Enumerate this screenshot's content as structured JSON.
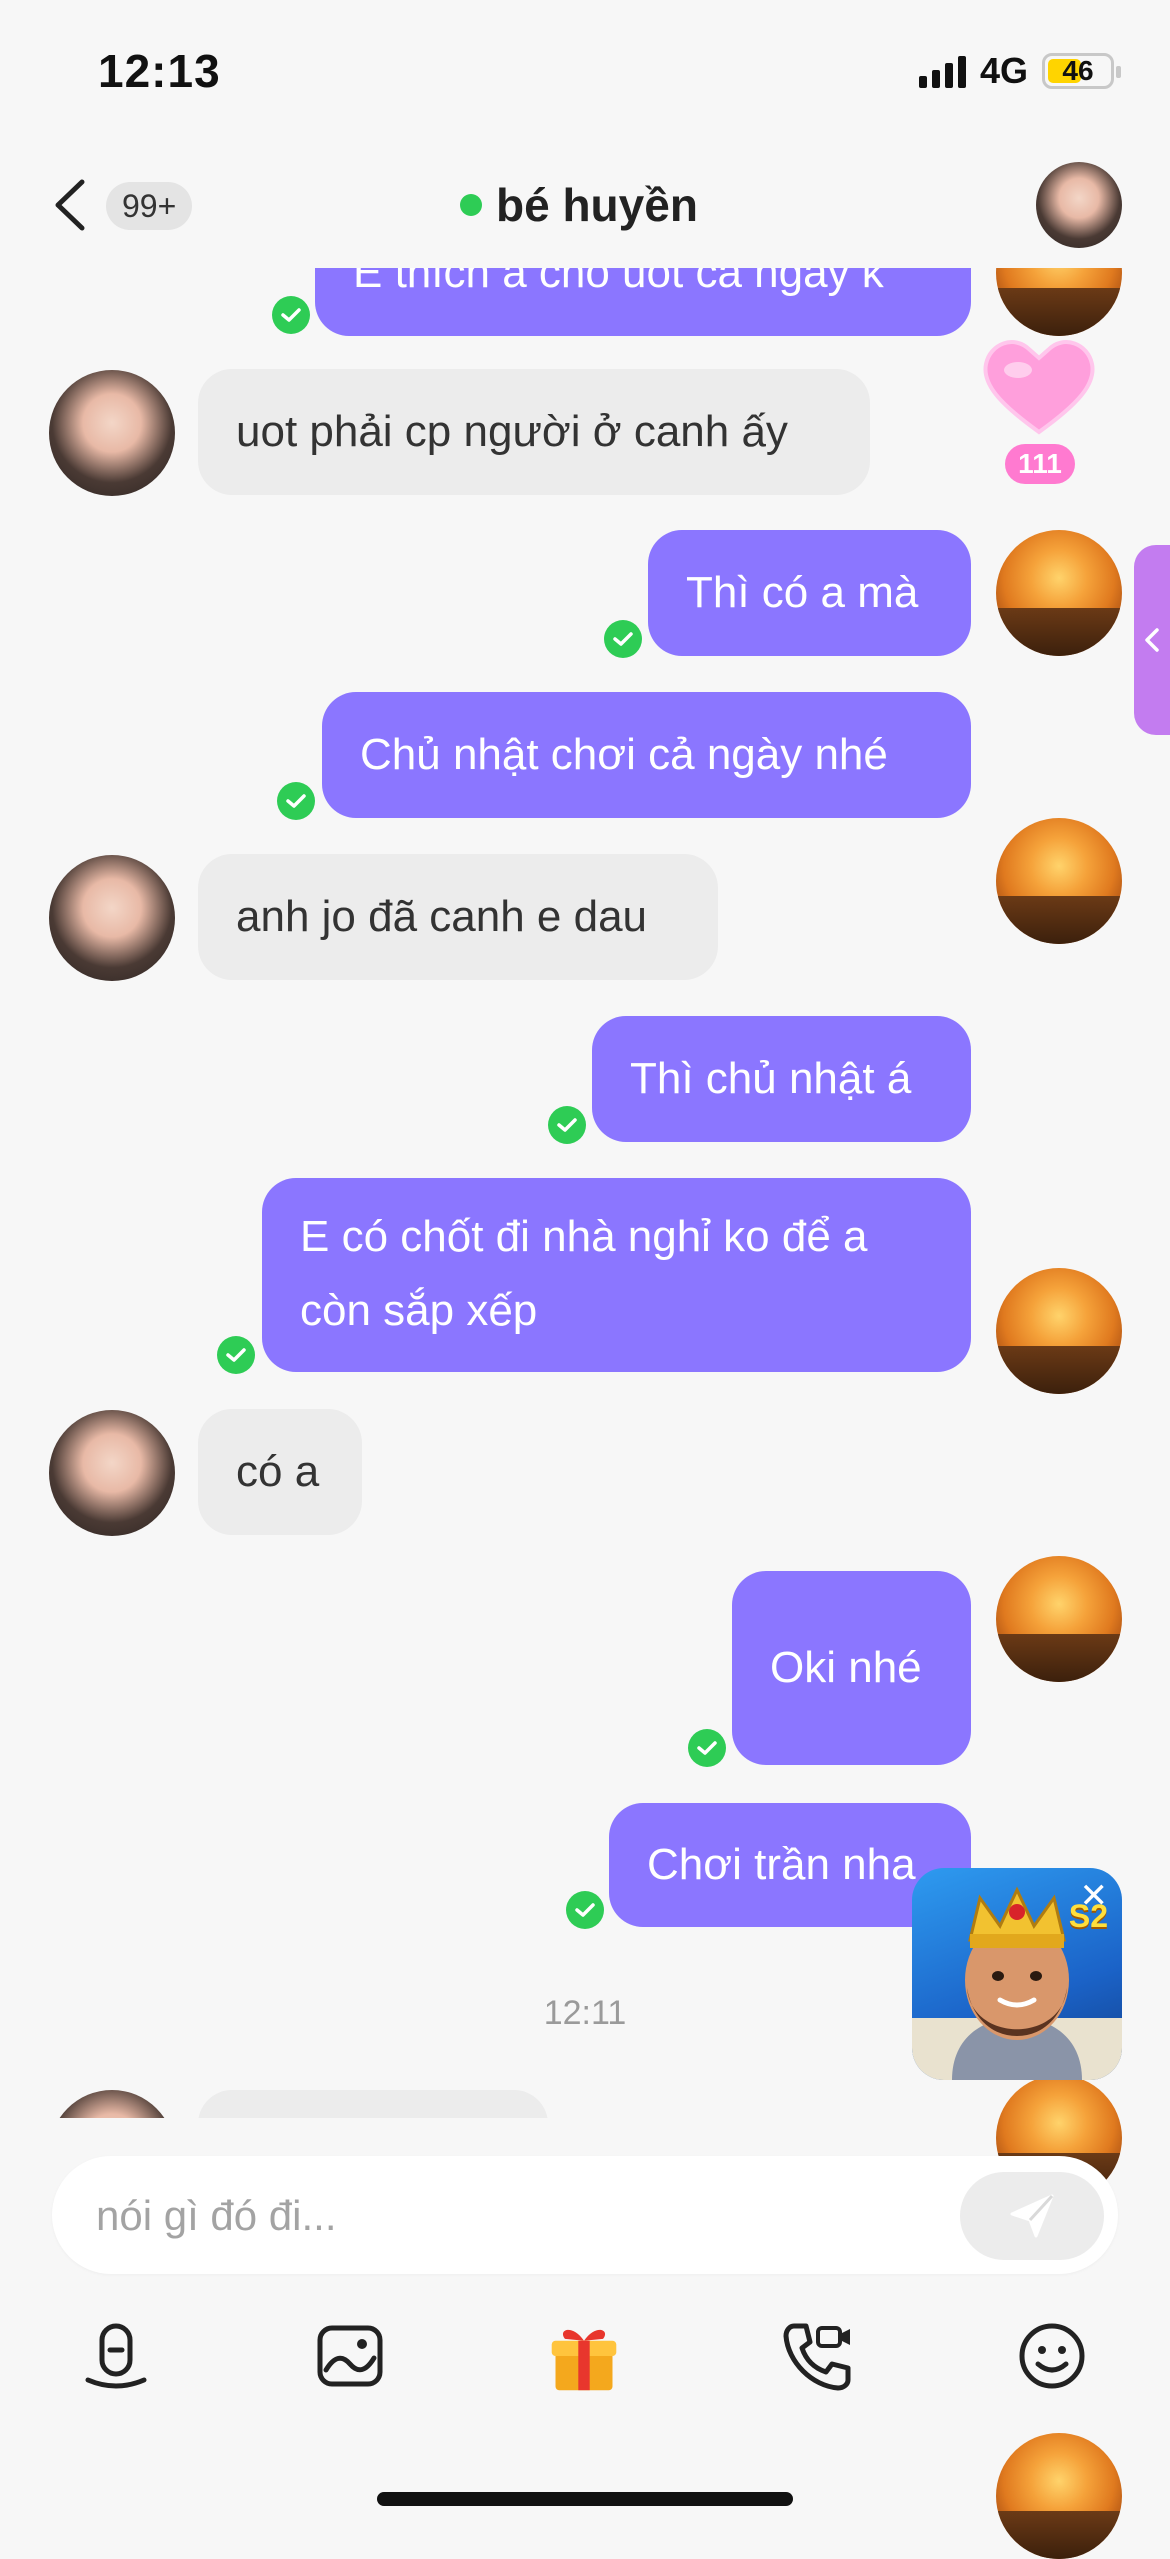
{
  "status_bar": {
    "time": "12:13",
    "network": "4G",
    "battery": "46"
  },
  "header": {
    "back_count": "99+",
    "title": "bé huyền",
    "online_color": "#2ecc55"
  },
  "messages": [
    {
      "from": "me",
      "text": "E thích a cho uot cả ngày k",
      "partial": true
    },
    {
      "from": "her",
      "text": "uot phải cp người ở canh ấy"
    },
    {
      "from": "me",
      "text": "Thì có a mà"
    },
    {
      "from": "me",
      "text": "Chủ nhật chơi cả ngày nhé"
    },
    {
      "from": "her",
      "text": "anh jo đã canh e dau"
    },
    {
      "from": "me",
      "text": "Thì chủ nhật á"
    },
    {
      "from": "me",
      "text": "E có chốt đi nhà nghỉ ko để a còn sắp xếp"
    },
    {
      "from": "her",
      "text": "có a"
    },
    {
      "from": "me",
      "text": "Oki nhé"
    },
    {
      "from": "me",
      "text": "Chơi trần nha"
    }
  ],
  "time_separator": "12:11",
  "heart_sticker": {
    "count": "111",
    "icon": "heart-icon"
  },
  "game_ad": {
    "badge": "S2",
    "close_label": "✕",
    "icon": "king-character"
  },
  "composer": {
    "placeholder": "nói gì đó đi..."
  },
  "toolbar": [
    "voice-icon",
    "image-icon",
    "gift-icon",
    "video-call-icon",
    "emoji-icon"
  ],
  "colors": {
    "outgoing_bubble": "#8b76ff",
    "incoming_bubble": "#ececec",
    "read_check": "#2ecc55"
  }
}
